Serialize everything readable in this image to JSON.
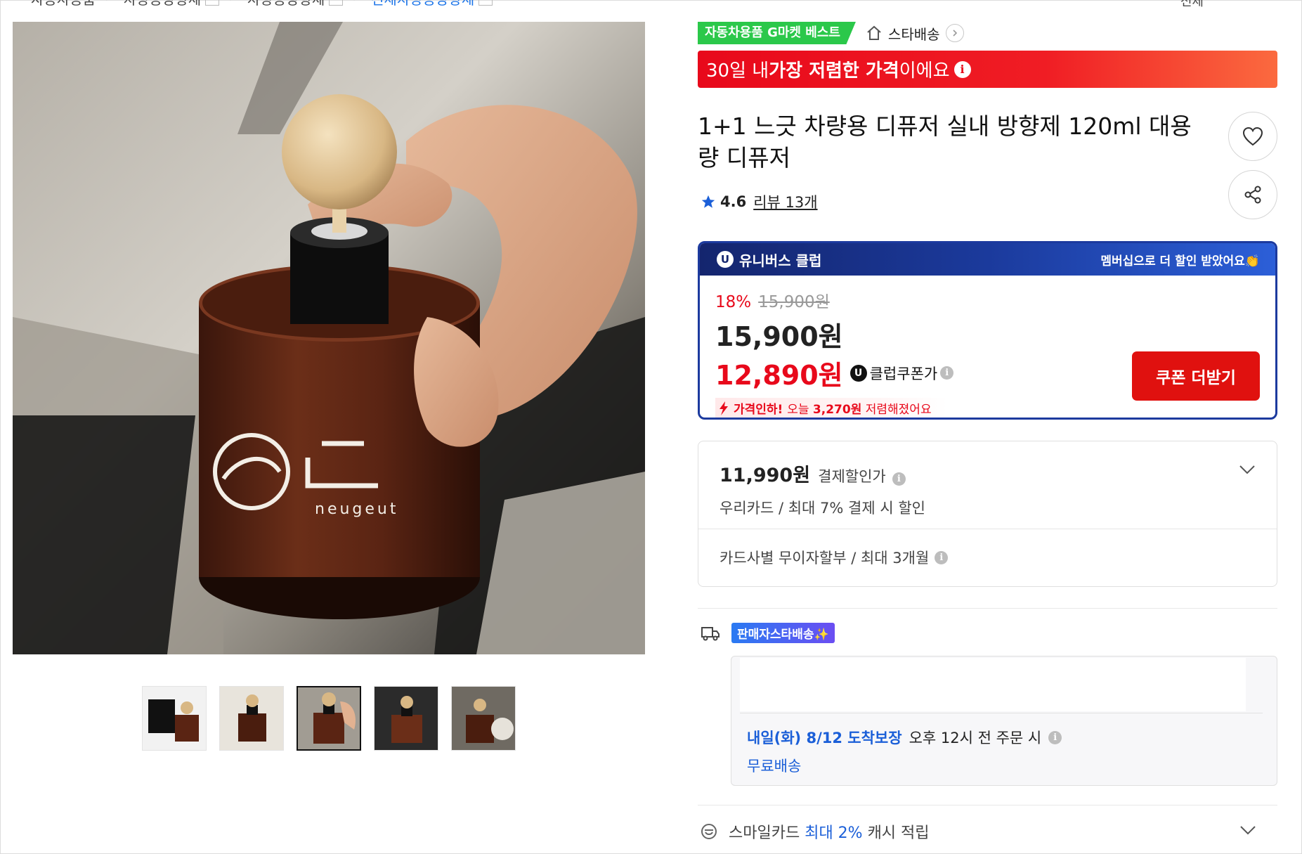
{
  "breadcrumb": {
    "items": [
      "자동차용품",
      "차량용방향제",
      "차량용방향제",
      "전체차량용방향제"
    ]
  },
  "header_right": "전체",
  "gallery": {
    "main_alt": "neugeut car diffuser bottle",
    "thumbnails": [
      "thumb-1",
      "thumb-2",
      "thumb-3",
      "thumb-4",
      "thumb-5"
    ],
    "active_index": 2,
    "product_label_word": "neugeut"
  },
  "badges": {
    "best": "자동차용품 G마켓 베스트",
    "star_delivery": "스타배송"
  },
  "price_banner": {
    "pre": "30일 내 ",
    "bold": "가장 저렴한 가격",
    "post": "이에요"
  },
  "product": {
    "title": "1+1 느긋 차량용 디퓨저 실내 방향제 120ml 대용량 디퓨저",
    "rating": "4.6",
    "reviews": "리뷰 13개"
  },
  "club": {
    "name": "유니버스 클럽",
    "u_mark": "U",
    "promo": "멤버십으로 더 할인 받았어요👏",
    "discount_rate": "18%",
    "original_price": "15,900원",
    "sale_price": "15,900원",
    "coupon_price": "12,890원",
    "coupon_label": "클럽쿠폰가",
    "drop_pre": "가격인하! ",
    "drop_text": "오늘 ",
    "drop_amount": "3,270원",
    "drop_post": " 저렴해졌어요",
    "coupon_button": "쿠폰 더받기"
  },
  "payment": {
    "price": "11,990원",
    "label": "결제할인가",
    "sub": "우리카드 / 최대 7% 결제 시 할인",
    "installment": "카드사별 무이자할부 / 최대 3개월"
  },
  "shipping": {
    "seller_badge": "판매자스타배송✨",
    "arrival_date": "내일(화) 8/12 도착보장",
    "arrival_condition": "오후 12시 전 주문 시",
    "free": "무료배송"
  },
  "cashback": {
    "pre": "스마일카드 ",
    "highlight": "최대 2%",
    "post": " 캐시 적립"
  },
  "colors": {
    "accent_red": "#e8091b",
    "club_navy": "#1c3a9e",
    "link_blue": "#1b5fd8",
    "best_green": "#2bc84a"
  }
}
